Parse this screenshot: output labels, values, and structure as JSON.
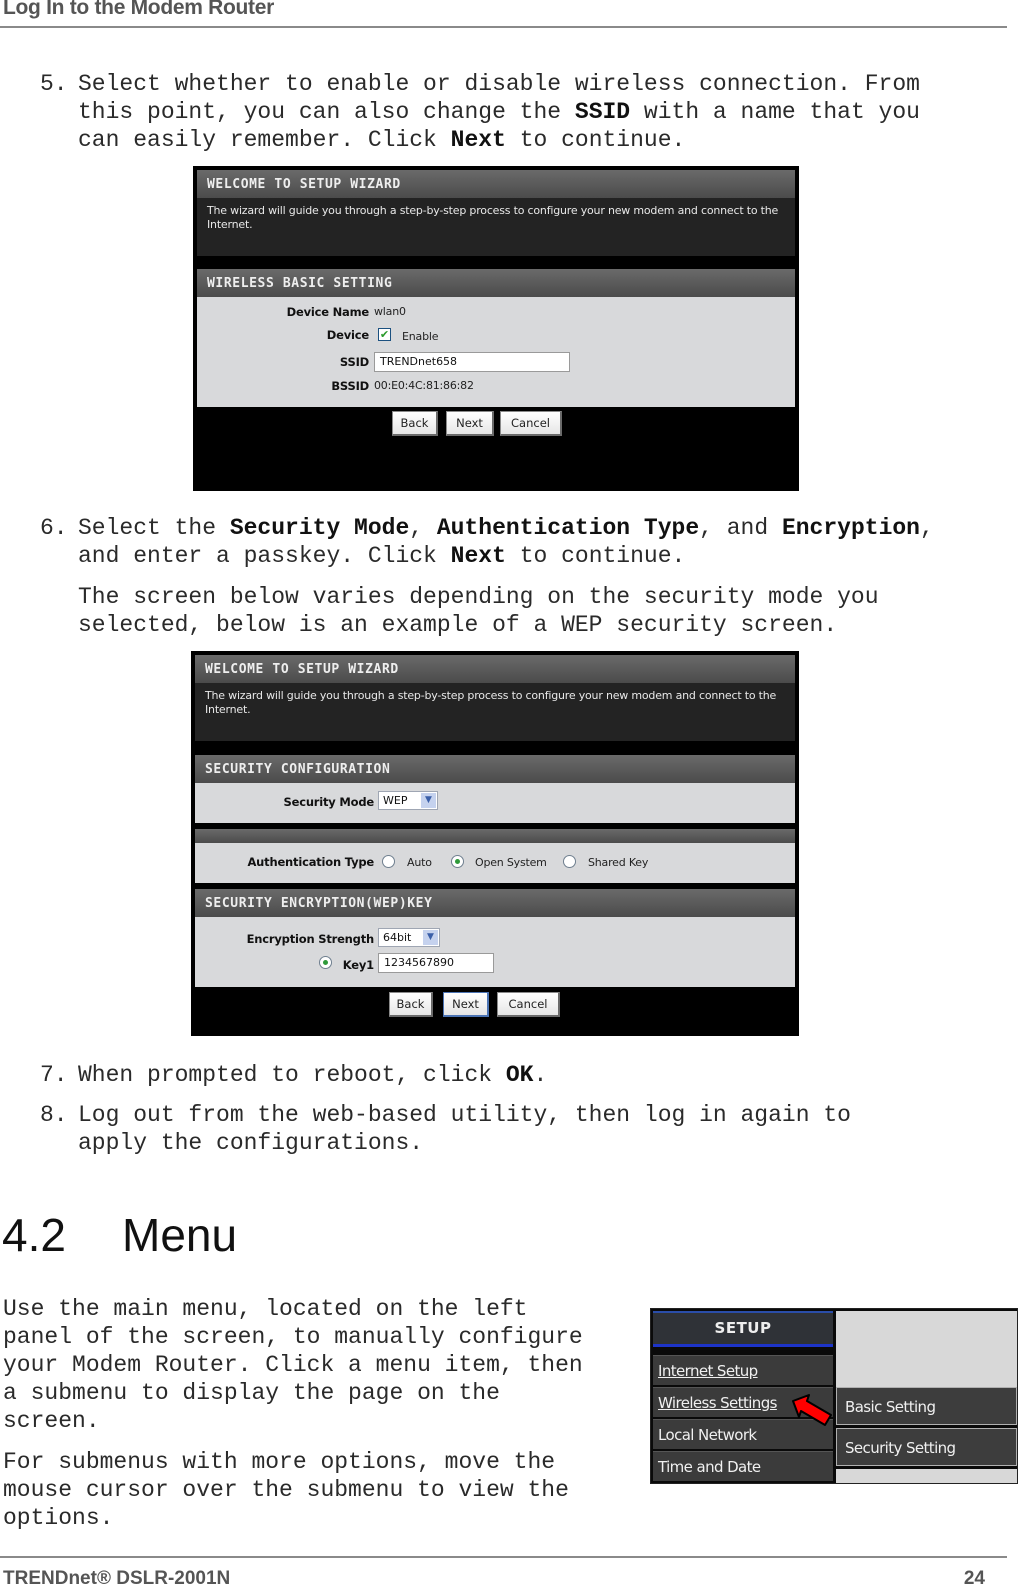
{
  "header": {
    "title": "Log In to the Modem Router"
  },
  "steps": {
    "s5": {
      "num": "5.",
      "line1": "Select whether to enable or disable wireless connection. From",
      "line2_a": "this point, you can also change the ",
      "line2_b": "SSID",
      "line2_c": " with a name that you",
      "line3_a": "can easily remember. Click ",
      "line3_b": "Next",
      "line3_c": " to continue."
    },
    "s6": {
      "num": "6.",
      "line1_a": "Select the ",
      "line1_b": "Security Mode",
      "line1_c": ", ",
      "line1_d": "Authentication Type",
      "line1_e": ", and ",
      "line1_f": "Encryption",
      "line1_g": ",",
      "line2_a": "and enter a passkey. Click ",
      "line2_b": "Next",
      "line2_c": " to continue.",
      "note1": "The screen below varies depending on the security mode you",
      "note2": "selected, below is an example of a WEP security screen."
    },
    "s7": {
      "num": "7.",
      "text_a": "When prompted to reboot, click ",
      "text_b": "OK",
      "text_c": "."
    },
    "s8": {
      "num": "8.",
      "line1": "Log out from the web-based utility, then log in again to",
      "line2": "apply the configurations."
    }
  },
  "wizard1": {
    "welcome_title": "WELCOME TO SETUP WIZARD",
    "welcome_desc": "The wizard will guide you through a step-by-step process to configure your new modem and connect to the Internet.",
    "section_title": "WIRELESS BASIC SETTING",
    "device_name_label": "Device Name",
    "device_name_value": "wlan0",
    "device_label": "Device",
    "device_enable_label": "Enable",
    "device_enable_checked": true,
    "ssid_label": "SSID",
    "ssid_value": "TRENDnet658",
    "bssid_label": "BSSID",
    "bssid_value": "00:E0:4C:81:86:82",
    "back_label": "Back",
    "next_label": "Next",
    "cancel_label": "Cancel"
  },
  "wizard2": {
    "welcome_title": "WELCOME TO SETUP WIZARD",
    "welcome_desc": "The wizard will guide you through a step-by-step process to configure your new modem and connect to the Internet.",
    "security_config_title": "SECURITY CONFIGURATION",
    "security_mode_label": "Security Mode",
    "security_mode_value": "WEP",
    "auth_type_label": "Authentication Type",
    "auth_options": [
      {
        "label": "Auto",
        "selected": false
      },
      {
        "label": "Open System",
        "selected": true
      },
      {
        "label": "Shared Key",
        "selected": false
      }
    ],
    "encryption_title": "SECURITY ENCRYPTION(WEP)KEY",
    "encryption_strength_label": "Encryption Strength",
    "encryption_strength_value": "64bit",
    "key1_label": "Key1",
    "key1_value": "1234567890",
    "back_label": "Back",
    "next_label": "Next",
    "cancel_label": "Cancel"
  },
  "section": {
    "number": "4.2",
    "title": "Menu"
  },
  "menu_text": {
    "p1_l1": "Use the main menu, located on the left",
    "p1_l2": "panel of the screen, to manually configure",
    "p1_l3": "your Modem Router. Click a menu item, then",
    "p1_l4": "a submenu to display the page on the",
    "p1_l5": "screen.",
    "p2_l1": "For submenus with more options, move the",
    "p2_l2": "mouse cursor over the submenu to view the",
    "p2_l3": "options."
  },
  "menu_shot": {
    "heading": "SETUP",
    "items": [
      "Internet Setup",
      "Wireless Settings",
      "Local Network",
      "Time and Date"
    ],
    "submenu": [
      "Basic Setting",
      "Security Setting"
    ],
    "arrow_color": "#ff0000"
  },
  "footer": {
    "brand": "TRENDnet® DSLR-2001N",
    "page": "24"
  }
}
